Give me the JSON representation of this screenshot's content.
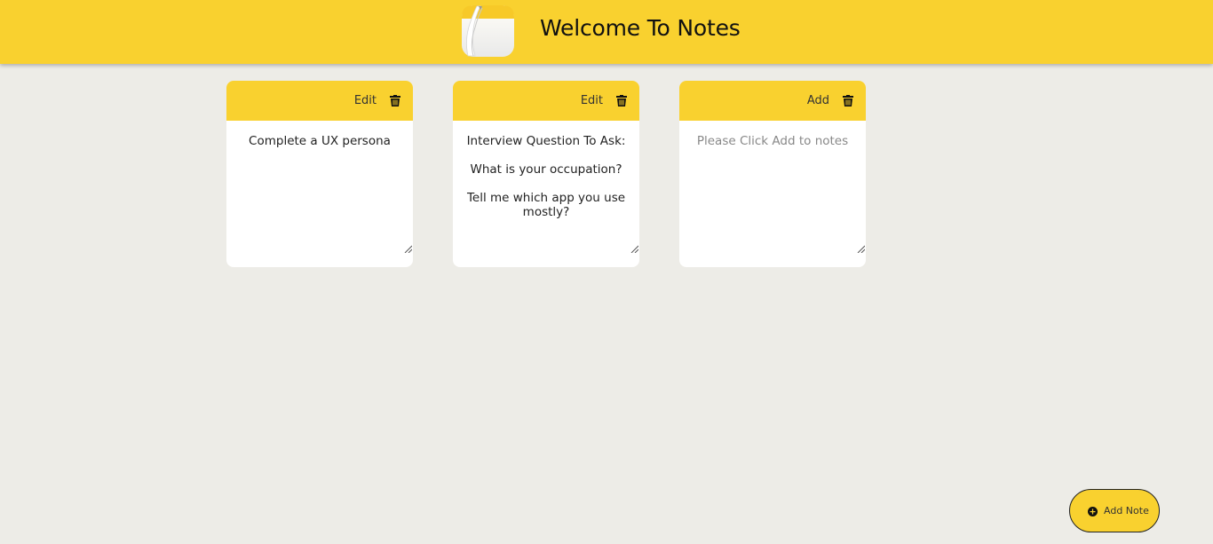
{
  "header": {
    "title": "Welcome To Notes",
    "logo_icon": "notes-app-icon",
    "background": "#f9d12f"
  },
  "notes": [
    {
      "action_label": "Edit",
      "text": "Complete a UX persona",
      "placeholder": ""
    },
    {
      "action_label": "Edit",
      "text": "Interview Question To Ask:\n\nWhat is your occupation?\n\nTell me which app you use mostly?",
      "placeholder": ""
    },
    {
      "action_label": "Add",
      "text": "",
      "placeholder": "Please Click Add  to notes"
    }
  ],
  "fab": {
    "label": "Add Note",
    "icon": "plus-circle-icon"
  },
  "colors": {
    "accent": "#f9d12f",
    "page_background": "#edece7",
    "card_background": "#ffffff"
  }
}
